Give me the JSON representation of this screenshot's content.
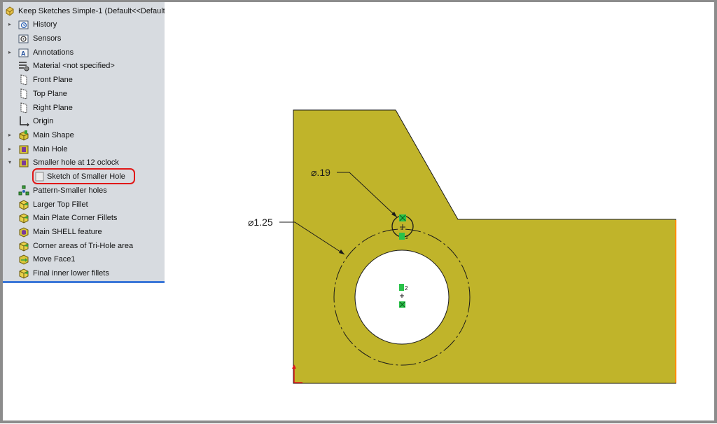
{
  "feature_tree": {
    "root": {
      "label": "Keep Sketches Simple-1  (Default<<Default>",
      "icon": "part-icon"
    },
    "items": [
      {
        "label": "History",
        "icon": "history-folder-icon",
        "expandable": true
      },
      {
        "label": "Sensors",
        "icon": "sensors-folder-icon",
        "expandable": false
      },
      {
        "label": "Annotations",
        "icon": "annotations-folder-icon",
        "expandable": true
      },
      {
        "label": "Material <not specified>",
        "icon": "material-icon",
        "expandable": false
      },
      {
        "label": "Front Plane",
        "icon": "plane-icon",
        "expandable": false
      },
      {
        "label": "Top Plane",
        "icon": "plane-icon",
        "expandable": false
      },
      {
        "label": "Right Plane",
        "icon": "plane-icon",
        "expandable": false
      },
      {
        "label": "Origin",
        "icon": "origin-icon",
        "expandable": false
      },
      {
        "label": "Main Shape",
        "icon": "extrude-icon",
        "expandable": true
      },
      {
        "label": "Main Hole",
        "icon": "cut-extrude-icon",
        "expandable": true
      },
      {
        "label": "Smaller hole at 12 oclock",
        "icon": "cut-extrude-icon",
        "expandable": true,
        "expanded": true
      },
      {
        "label": "Sketch of Smaller Hole",
        "icon": "sketch-icon",
        "child": true,
        "selected": true
      },
      {
        "label": "Pattern-Smaller holes",
        "icon": "circular-pattern-icon",
        "expandable": false
      },
      {
        "label": "Larger Top Fillet",
        "icon": "fillet-icon",
        "expandable": false
      },
      {
        "label": "Main Plate Corner Fillets",
        "icon": "fillet-icon",
        "expandable": false
      },
      {
        "label": "Main SHELL feature",
        "icon": "shell-icon",
        "expandable": false
      },
      {
        "label": "Corner areas of Tri-Hole area",
        "icon": "fillet-icon",
        "expandable": false
      },
      {
        "label": "Move Face1",
        "icon": "move-face-icon",
        "expandable": false
      },
      {
        "label": "Final inner lower fillets",
        "icon": "fillet-icon",
        "expandable": false
      }
    ]
  },
  "viewport": {
    "part_color": "#c0b42a",
    "dimensions": {
      "small_hole": "⌀.19",
      "large_circle": "⌀1.25"
    },
    "relation_labels": {
      "center_relation": "2",
      "small_hole_relation": "2"
    }
  }
}
